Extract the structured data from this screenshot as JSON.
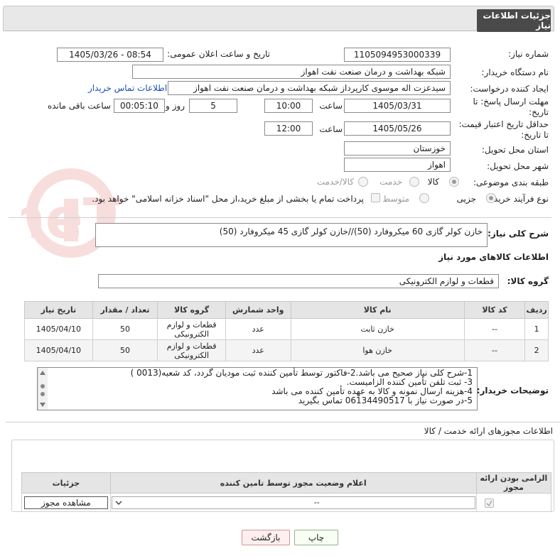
{
  "header": {
    "title": "جزئیات اطلاعات نیاز"
  },
  "form": {
    "need_number_label": "شماره نیاز:",
    "need_number": "1105094953000339",
    "announce_label": "تاریخ و ساعت اعلان عمومی:",
    "announce_value": "1405/03/26 - 08:54",
    "buyer_label": "نام دستگاه خریدار:",
    "buyer_value": "شبکه بهداشت و درمان صنعت نفت اهواز",
    "creator_label": "ایجاد کننده درخواست:",
    "creator_value": "سیدعزت اله موسوی کارپرداز شبکه بهداشت و درمان صنعت نفت اهواز",
    "contact_link": "اطلاعات تماس خریدار",
    "deadline_label_1": "مهلت ارسال پاسخ: تا",
    "deadline_label_2": "تاریخ:",
    "deadline_date": "1405/03/31",
    "time_label": "ساعت",
    "deadline_time": "10:00",
    "days_value": "5",
    "days_label": "روز و",
    "remaining_value": "00:05:10",
    "remaining_label": "ساعت باقی مانده",
    "validity_label_1": "حداقل تاریخ اعتبار قیمت:",
    "validity_label_2": "تا تاریخ:",
    "validity_date": "1405/05/26",
    "validity_time": "12:00",
    "province_label": "استان محل تحویل:",
    "province_value": "خوزستان",
    "city_label": "شهر محل تحویل:",
    "city_value": "اهواز",
    "category_label": "طبقه بندی موضوعی:",
    "category_options": [
      "کالا",
      "خدمت",
      "کالا/خدمت"
    ],
    "process_label": "نوع فرآیند خرید :",
    "process_options": [
      "جزیی",
      "متوسط"
    ],
    "payment_text": "پرداخت تمام یا بخشی از مبلغ خرید،از محل \"اسناد خزانه اسلامی\" خواهد بود."
  },
  "summary": {
    "label": "شرح کلی نیاز:",
    "value": "خازن کولر گازی 60 میکروفارد (50)//خازن کولر گازی 45 میکروفارد (50)"
  },
  "goods": {
    "section_title": "اطلاعات کالاهای مورد نیاز",
    "group_label": "گروه کالا:",
    "group_value": "قطعات و لوازم الکترونیکی",
    "columns": [
      "ردیف",
      "کد کالا",
      "نام کالا",
      "واحد شمارش",
      "گروه کالا",
      "تعداد / مقدار",
      "تاریخ نیاز"
    ],
    "rows": [
      {
        "row": "1",
        "code": "--",
        "name": "خازن ثابت",
        "unit": "عدد",
        "group": "قطعات و لوازم الکترونیکی",
        "qty": "50",
        "date": "1405/04/10"
      },
      {
        "row": "2",
        "code": "--",
        "name": "خازن هوا",
        "unit": "عدد",
        "group": "قطعات و لوازم الکترونیکی",
        "qty": "50",
        "date": "1405/04/10"
      }
    ]
  },
  "buyer_notes": {
    "label": "توضیحات خریدار:",
    "lines": [
      "1-شرح کلی نیاز صحیح می باشد.2-فاکتور توسط تأمین کننده ثبت مودیان گردد، کد شعبه(0013 )",
      "3- ثبت تلفن تأمین کننده الزامیست.",
      "4-هزینه ارسال نمونه و کالا به عهده تأمین کننده می باشد",
      "5-در صورت نیاز با 06134490517 تماس بگیرید"
    ]
  },
  "licenses": {
    "title": "اطلاعات مجوزهای ارائه خدمت / کالا",
    "columns": [
      "الزامی بودن ارائه مجوز",
      "اعلام وضعیت مجوز توسط تامین کننده",
      "جزئیات"
    ],
    "select_value": "--",
    "view_button": "مشاهده مجوز"
  },
  "footer": {
    "print_button": "چاپ",
    "back_button": "بازگشت"
  },
  "watermark": {
    "text": "AriaTender.neT"
  }
}
